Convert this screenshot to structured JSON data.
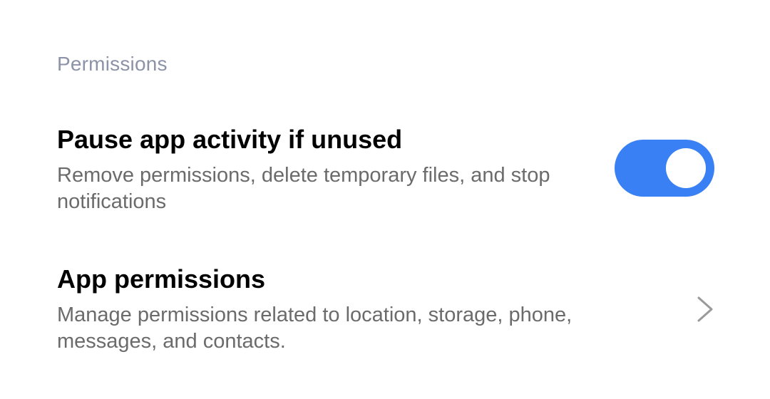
{
  "section": {
    "header": "Permissions"
  },
  "pause_app_activity": {
    "title": "Pause app activity if unused",
    "summary": "Remove permissions, delete temporary files, and stop notifications",
    "toggle_on": true,
    "toggle_color": "#3a80f5"
  },
  "app_permissions": {
    "title": "App permissions",
    "summary": "Manage permissions related to location, storage, phone, messages, and contacts.",
    "chevron_icon": "chevron-right-icon"
  },
  "colors": {
    "header_text": "#8c93a8",
    "title_text": "#000000",
    "summary_text": "#6b6b6b",
    "background": "#ffffff"
  }
}
